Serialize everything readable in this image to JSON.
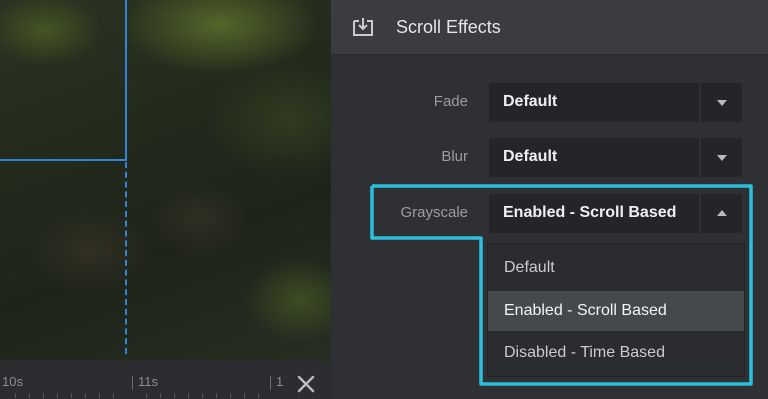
{
  "panel": {
    "title": "Scroll Effects",
    "icon": "download-box-icon",
    "settings": [
      {
        "label": "Fade",
        "value": "Default",
        "open": false
      },
      {
        "label": "Blur",
        "value": "Default",
        "open": false
      },
      {
        "label": "Grayscale",
        "value": "Enabled - Scroll Based",
        "open": true
      }
    ],
    "dropdown": {
      "options": [
        "Default",
        "Enabled - Scroll Based",
        "Disabled - Time Based"
      ],
      "selected": "Enabled - Scroll Based"
    }
  },
  "timeline": {
    "labels": [
      "10s",
      "11s",
      "1"
    ],
    "close_icon": "close-icon"
  },
  "colors": {
    "selection_blue": "#2f86d8",
    "highlight_cyan": "#2cc0dd",
    "panel_bg": "#2e3033",
    "header_bg": "#3a3c40"
  }
}
